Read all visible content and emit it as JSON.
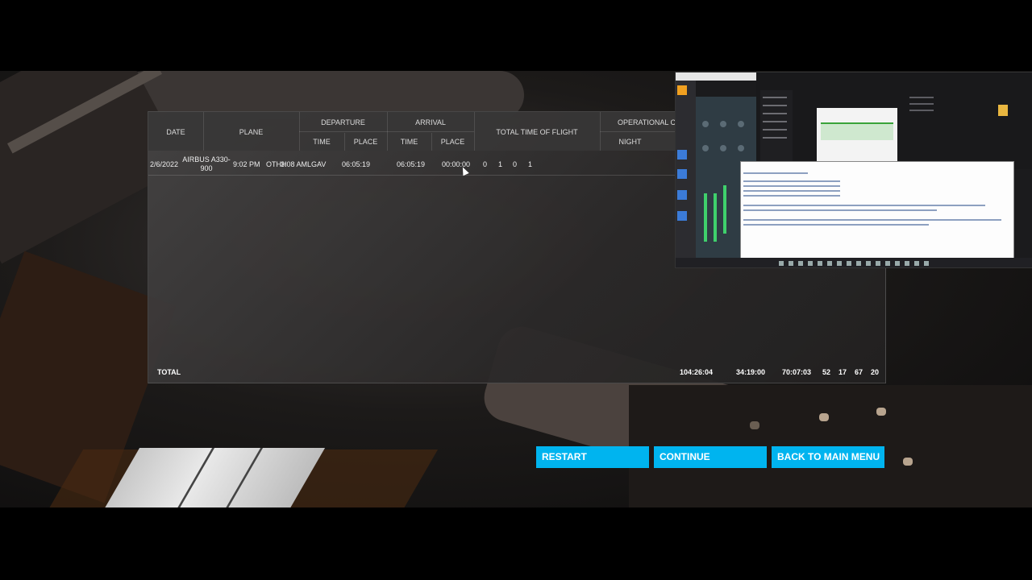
{
  "logbook": {
    "headers": {
      "date": "DATE",
      "plane": "PLANE",
      "departure": "DEPARTURE",
      "arrival": "ARRIVAL",
      "time": "TIME",
      "place": "PLACE",
      "total_time": "TOTAL TIME OF FLIGHT",
      "operational": "OPERATIONAL CO",
      "night": "NIGHT"
    },
    "rows": [
      {
        "date": "2/6/2022",
        "plane": "AIRBUS A330-900",
        "departure_time": "9:02 PM",
        "departure_place": "OTHH",
        "arrival_time": "3:08 AM",
        "arrival_place": "LGAV",
        "total_time": "06:05:19",
        "col_a": "06:05:19",
        "col_b": "00:00:00",
        "counts": [
          "0",
          "1",
          "0",
          "1"
        ]
      }
    ],
    "totals": {
      "label": "TOTAL",
      "total_time": "104:26:04",
      "col_a": "34:19:00",
      "col_b": "70:07:03",
      "counts": [
        "52",
        "17",
        "67",
        "20"
      ]
    }
  },
  "buttons": {
    "restart": "RESTART",
    "continue": "CONTINUE",
    "main_menu": "BACK TO MAIN MENU"
  },
  "colors": {
    "accent": "#00b4ef"
  }
}
